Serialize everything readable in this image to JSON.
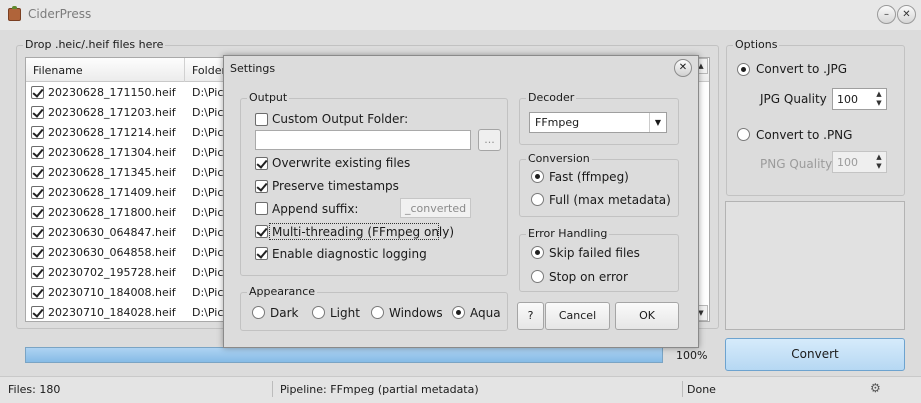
{
  "window": {
    "title": "CiderPress"
  },
  "drop_group": {
    "label": "Drop .heic/.heif files here",
    "columns": [
      "Filename",
      "Folder"
    ],
    "rows": [
      {
        "name": "20230628_171150.heif",
        "folder": "D:\\Pic"
      },
      {
        "name": "20230628_171203.heif",
        "folder": "D:\\Pic"
      },
      {
        "name": "20230628_171214.heif",
        "folder": "D:\\Pic"
      },
      {
        "name": "20230628_171304.heif",
        "folder": "D:\\Pic"
      },
      {
        "name": "20230628_171345.heif",
        "folder": "D:\\Pic"
      },
      {
        "name": "20230628_171409.heif",
        "folder": "D:\\Pic"
      },
      {
        "name": "20230628_171800.heif",
        "folder": "D:\\Pic"
      },
      {
        "name": "20230630_064847.heif",
        "folder": "D:\\Pic"
      },
      {
        "name": "20230630_064858.heif",
        "folder": "D:\\Pic"
      },
      {
        "name": "20230702_195728.heif",
        "folder": "D:\\Pic"
      },
      {
        "name": "20230710_184008.heif",
        "folder": "D:\\Pic"
      },
      {
        "name": "20230710_184028.heif",
        "folder": "D:\\Pic"
      }
    ]
  },
  "progress": {
    "fraction": 1.0,
    "text": "100%"
  },
  "options": {
    "label": "Options",
    "jpg_label": "Convert to .JPG",
    "jpg_quality_label": "JPG Quality",
    "jpg_quality": "100",
    "png_label": "Convert to .PNG",
    "png_quality_label": "PNG Quality",
    "png_quality": "100"
  },
  "convert_button": "Convert",
  "status": {
    "files": "Files: 180",
    "pipeline": "Pipeline: FFmpeg (partial metadata)",
    "state": "Done"
  },
  "settings": {
    "title": "Settings",
    "output": {
      "label": "Output",
      "custom_folder": "Custom Output Folder:",
      "browse": "...",
      "overwrite": "Overwrite existing files",
      "preserve": "Preserve timestamps",
      "append_suffix": "Append suffix:",
      "suffix_value": "_converted",
      "multithreading": "Multi-threading (FFmpeg only)",
      "diagnostic": "Enable diagnostic logging"
    },
    "appearance": {
      "label": "Appearance",
      "options": [
        "Dark",
        "Light",
        "Windows",
        "Aqua"
      ]
    },
    "decoder": {
      "label": "Decoder",
      "value": "FFmpeg"
    },
    "conversion": {
      "label": "Conversion",
      "fast": "Fast (ffmpeg)",
      "full": "Full (max metadata)"
    },
    "error_handling": {
      "label": "Error Handling",
      "skip": "Skip failed files",
      "stop": "Stop on error"
    },
    "help": "?",
    "cancel": "Cancel",
    "ok": "OK"
  },
  "colors": {
    "accent_button": "#b6d8f3",
    "progress": "#86bbe6"
  }
}
